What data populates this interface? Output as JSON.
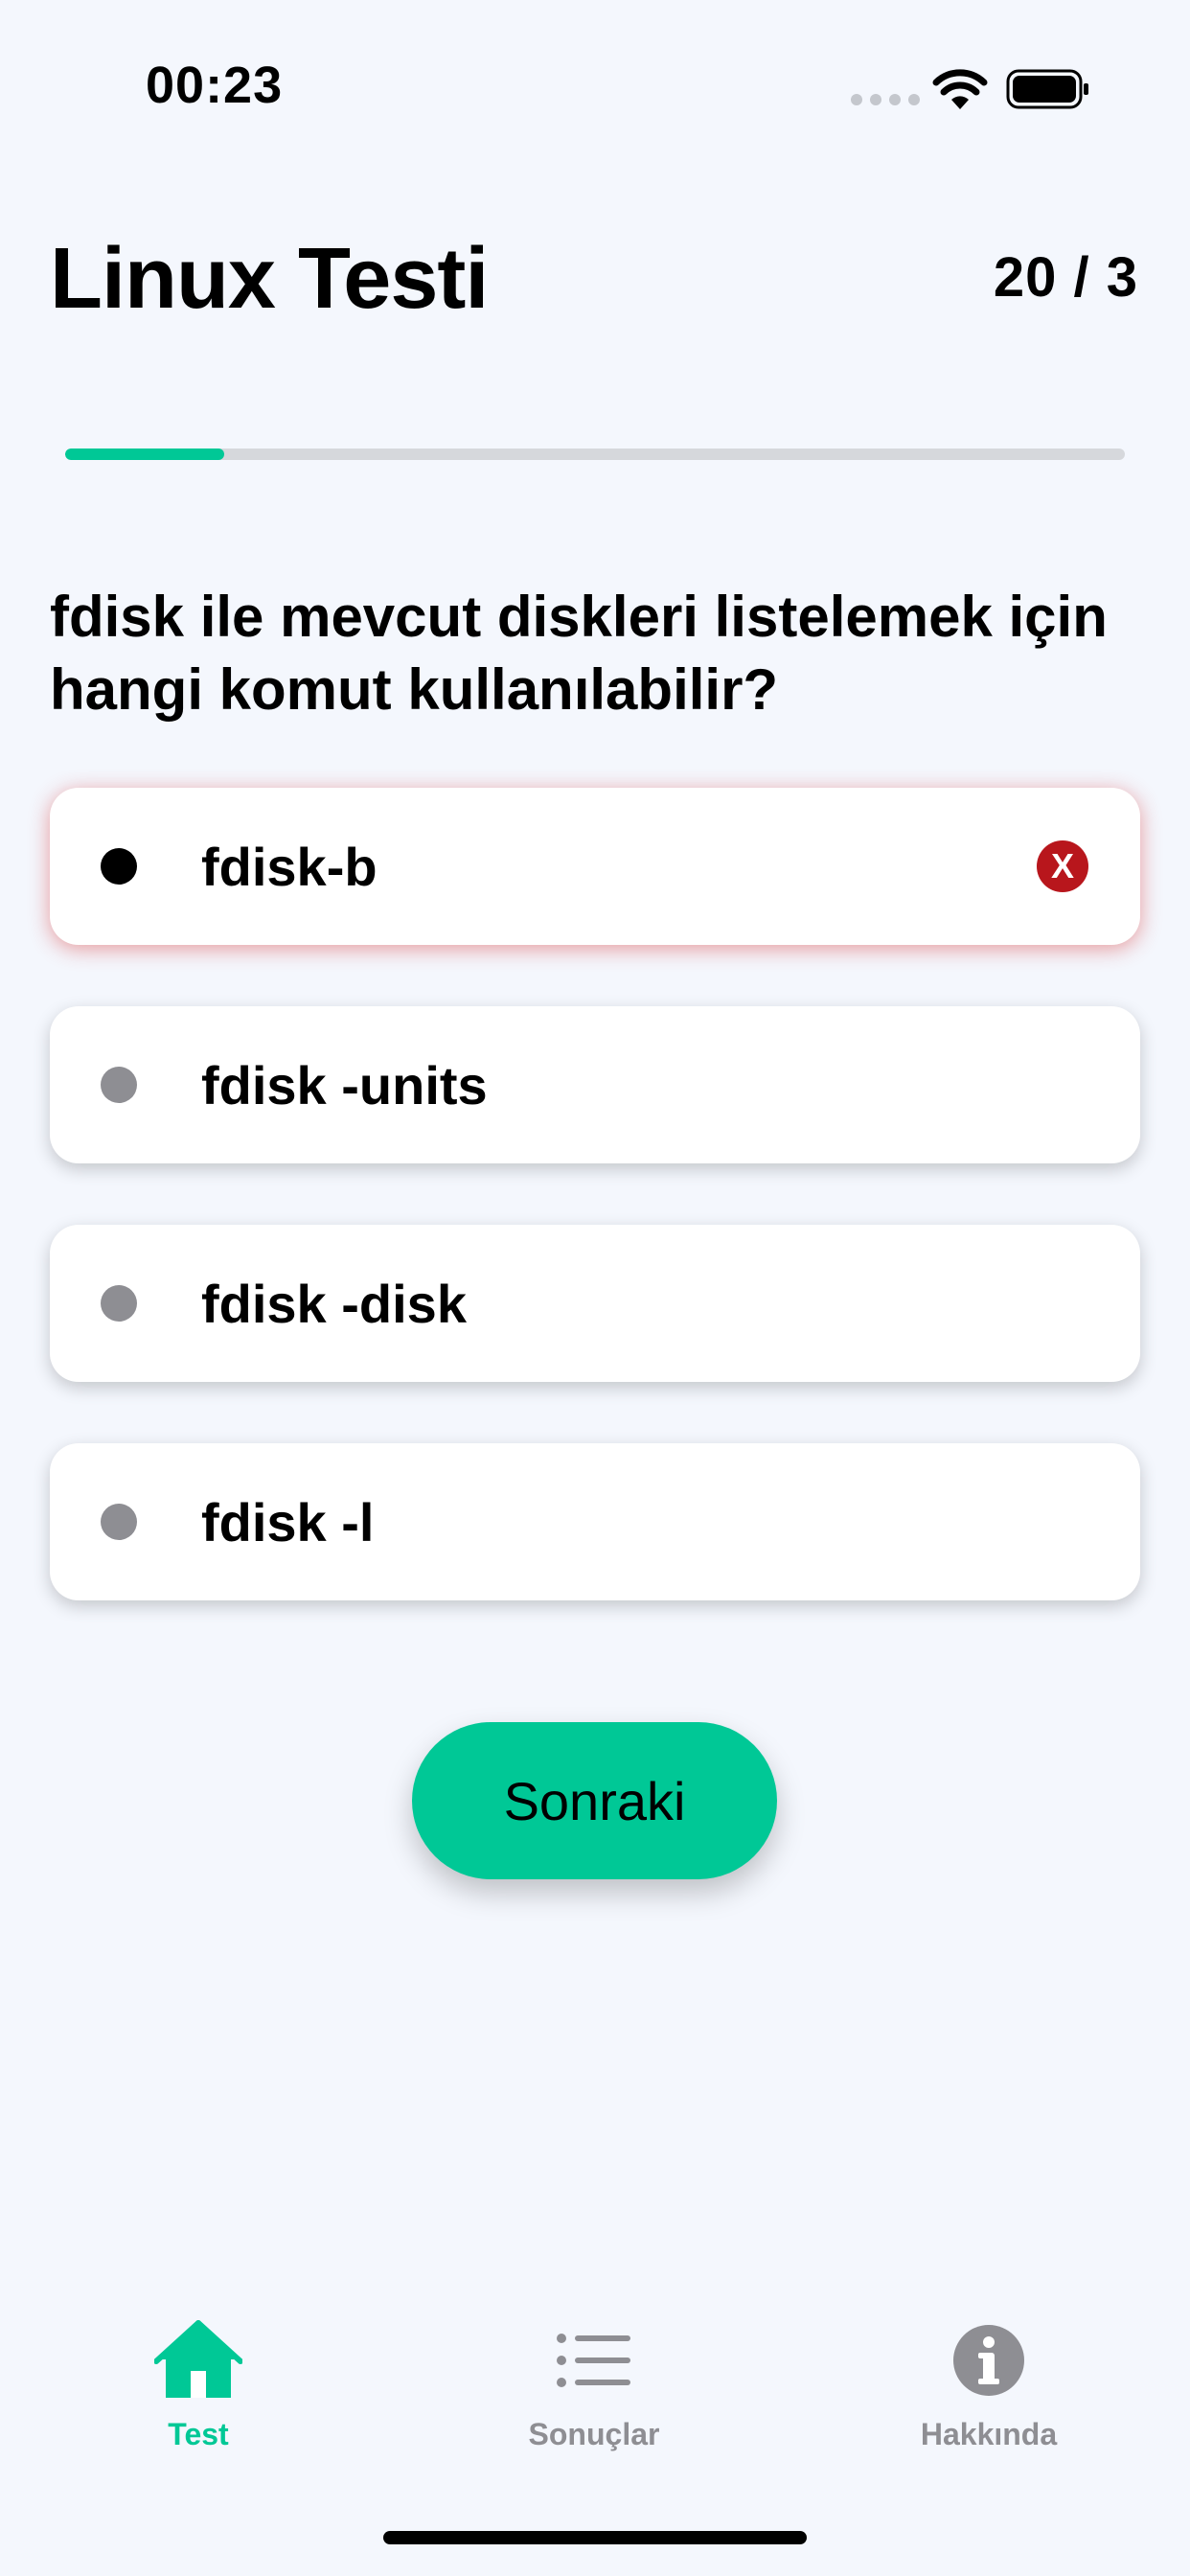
{
  "status_bar": {
    "time": "00:23"
  },
  "header": {
    "title": "Linux Testi",
    "counter": "20 / 3"
  },
  "progress": {
    "fraction": 0.15
  },
  "question": {
    "text": "fdisk ile mevcut diskleri listelemek için hangi komut kullanılabilir?"
  },
  "options": [
    {
      "label": "fdisk-b",
      "state": "selected-wrong",
      "mark": "X"
    },
    {
      "label": "fdisk -units",
      "state": "default"
    },
    {
      "label": "fdisk -disk",
      "state": "default"
    },
    {
      "label": "fdisk -l",
      "state": "default"
    }
  ],
  "next_button": {
    "label": "Sonraki"
  },
  "tab_bar": {
    "tabs": [
      {
        "label": "Test",
        "icon": "house-icon",
        "active": true
      },
      {
        "label": "Sonuçlar",
        "icon": "list-icon",
        "active": false
      },
      {
        "label": "Hakkında",
        "icon": "info-icon",
        "active": false
      }
    ]
  },
  "colors": {
    "accent": "#00c896",
    "wrong": "#b8161c",
    "background": "#f4f7fd"
  }
}
